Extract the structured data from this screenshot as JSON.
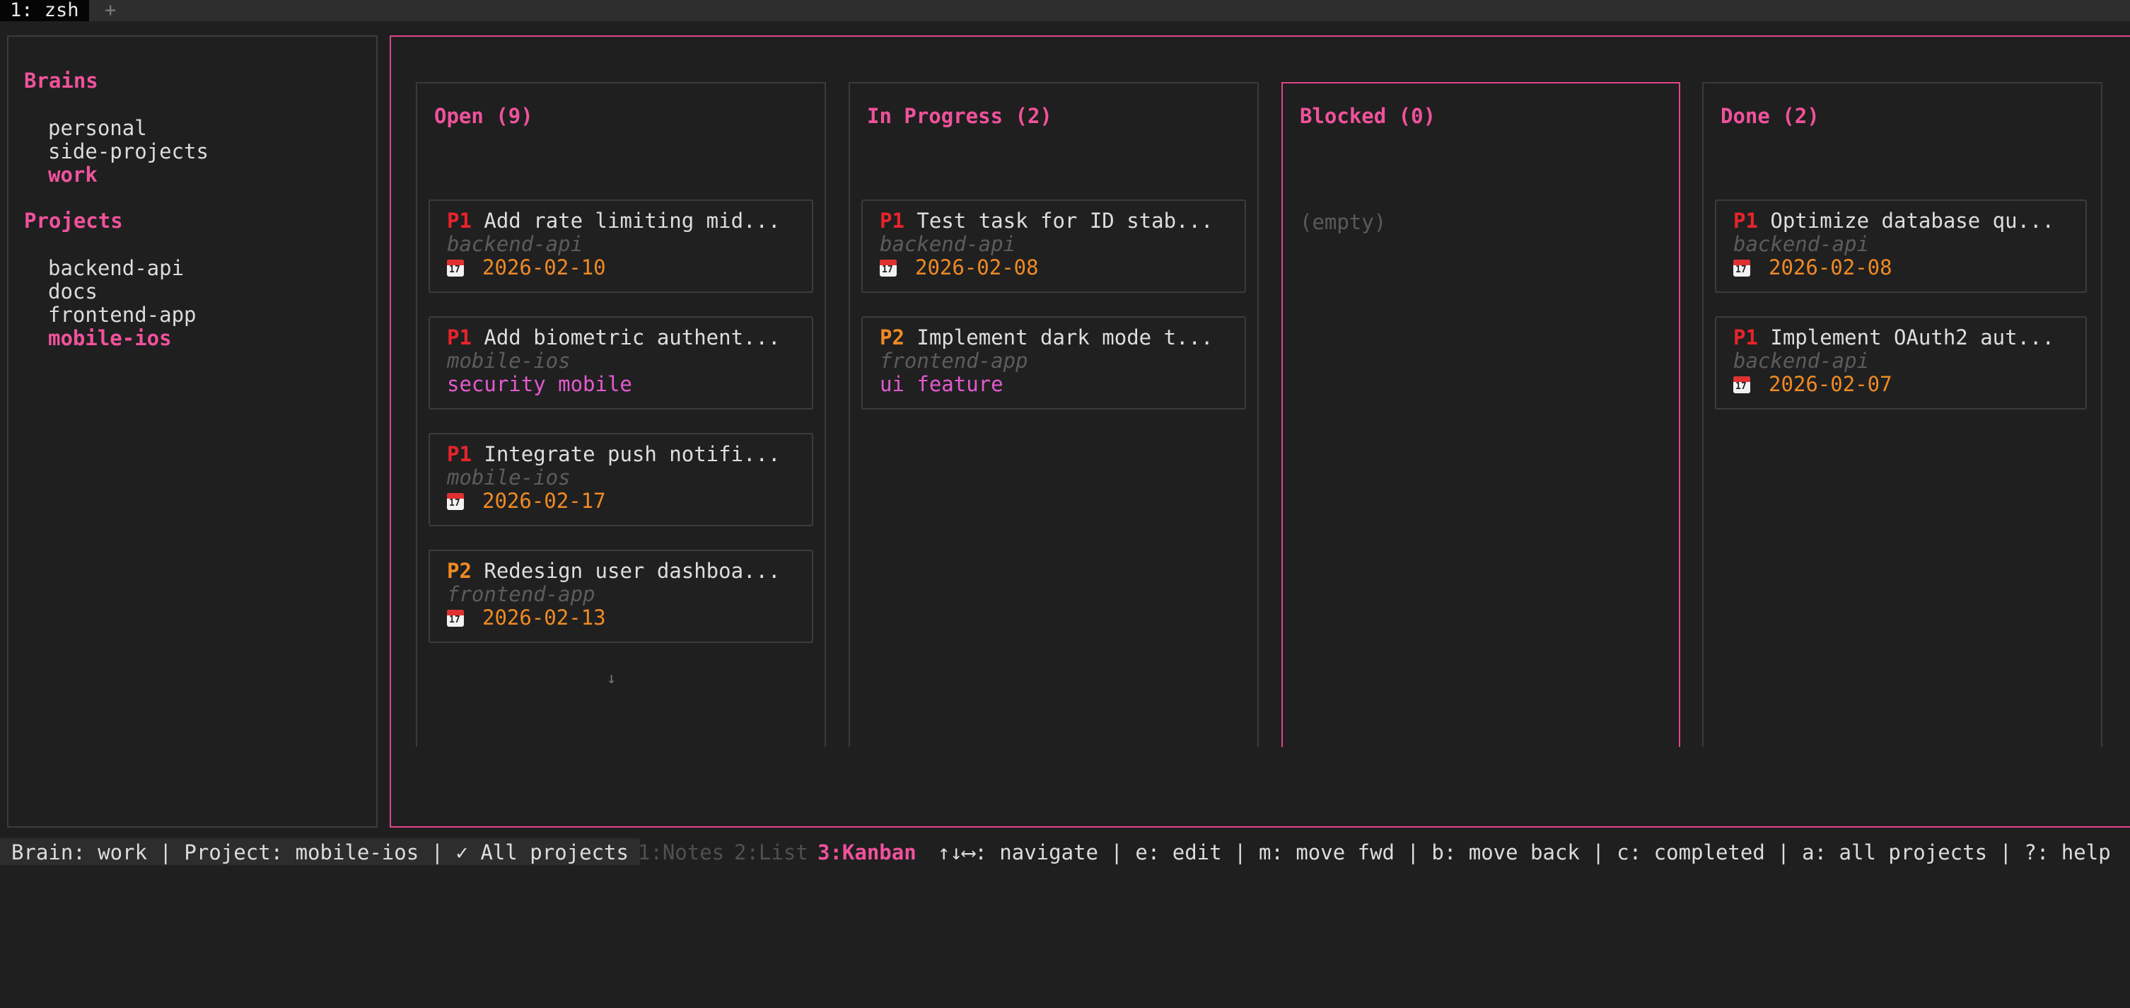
{
  "tabbar": {
    "active_tab": "1: zsh",
    "add_tab": "+"
  },
  "sidebar": {
    "brains_title": "Brains",
    "brains": [
      "personal",
      "side-projects",
      "work"
    ],
    "selected_brain": "work",
    "projects_title": "Projects",
    "projects": [
      "backend-api",
      "docs",
      "frontend-app",
      "mobile-ios"
    ],
    "selected_project": "mobile-ios"
  },
  "board": {
    "columns": [
      {
        "title": "Open (9)",
        "cards": [
          {
            "priority": "P1",
            "title": "Add rate limiting mid...",
            "project": "backend-api",
            "date": "2026-02-10"
          },
          {
            "priority": "P1",
            "title": "Add biometric authent...",
            "project": "mobile-ios",
            "tags": "security mobile"
          },
          {
            "priority": "P1",
            "title": "Integrate push notifi...",
            "project": "mobile-ios",
            "date": "2026-02-17"
          },
          {
            "priority": "P2",
            "title": "Redesign user dashboa...",
            "project": "frontend-app",
            "date": "2026-02-13"
          }
        ],
        "more_indicator": "↓"
      },
      {
        "title": "In Progress (2)",
        "cards": [
          {
            "priority": "P1",
            "title": "Test task for ID stab...",
            "project": "backend-api",
            "date": "2026-02-08"
          },
          {
            "priority": "P2",
            "title": "Implement dark mode t...",
            "project": "frontend-app",
            "tags": "ui feature"
          }
        ]
      },
      {
        "title": "Blocked (0)",
        "empty_text": "(empty)"
      },
      {
        "title": "Done (2)",
        "cards": [
          {
            "priority": "P1",
            "title": "Optimize database qu...",
            "project": "backend-api",
            "date": "2026-02-08"
          },
          {
            "priority": "P1",
            "title": "Implement OAuth2 aut...",
            "project": "backend-api",
            "date": "2026-02-07"
          }
        ]
      }
    ]
  },
  "statusbar": {
    "info": "Brain: work | Project: mobile-ios | ✓ All projects",
    "views": [
      "1:Notes",
      "2:List",
      "3:Kanban"
    ],
    "active_view": "3:Kanban",
    "keyhints": "↑↓⟷: navigate | e: edit | m: move fwd | b: move back | c: completed | a: all projects | ?: help"
  },
  "colors": {
    "accent": "#f0529c",
    "priority_p1": "#e8242b",
    "priority_p2": "#f08a24",
    "date": "#f08a24",
    "tags": "#e45ad0",
    "background": "#1f1f1f"
  },
  "icons": {
    "due_date": "calendar-icon"
  }
}
